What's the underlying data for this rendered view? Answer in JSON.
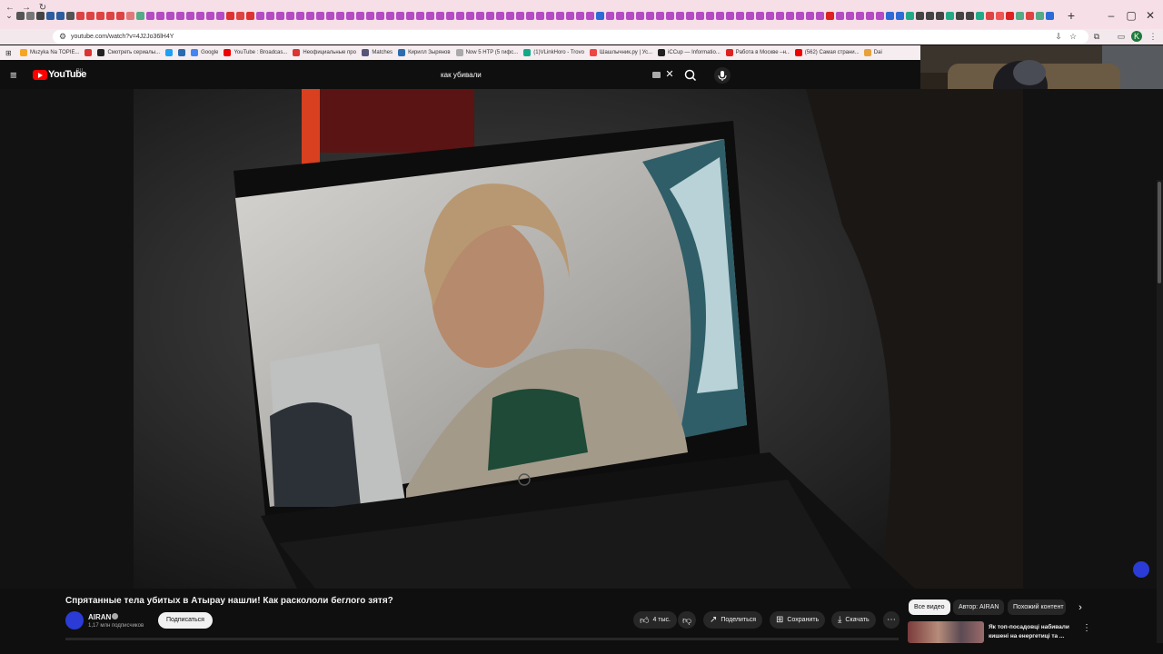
{
  "browser": {
    "url": "youtube.com/watch?v=4J2Jo36lH4Y",
    "tab_favicon_colors": [
      "#555",
      "#777",
      "#444",
      "#2d5d9f",
      "#2d5d9f",
      "#555",
      "#d44",
      "#d44",
      "#d44",
      "#d44",
      "#d44",
      "#e07a7a",
      "#5a8",
      "#b44cc4",
      "#b44cc4",
      "#b44cc4",
      "#b44cc4",
      "#b44cc4",
      "#b44cc4",
      "#b44cc4",
      "#b44cc4",
      "#d33",
      "#d44",
      "#d33",
      "#b44cc4",
      "#b44cc4",
      "#b44cc4",
      "#b44cc4",
      "#b44cc4",
      "#b44cc4",
      "#b44cc4",
      "#b44cc4",
      "#b44cc4",
      "#b44cc4",
      "#b44cc4",
      "#b44cc4",
      "#b44cc4",
      "#b44cc4",
      "#b44cc4",
      "#b44cc4",
      "#b44cc4",
      "#b44cc4",
      "#b44cc4",
      "#b44cc4",
      "#b44cc4",
      "#b44cc4",
      "#b44cc4",
      "#b44cc4",
      "#b44cc4",
      "#b44cc4",
      "#b44cc4",
      "#b44cc4",
      "#b44cc4",
      "#b44cc4",
      "#b44cc4",
      "#b44cc4",
      "#b44cc4",
      "#b44cc4",
      "#2d6bd6",
      "#b44cc4",
      "#b44cc4",
      "#b44cc4",
      "#b44cc4",
      "#b44cc4",
      "#b44cc4",
      "#b44cc4",
      "#b44cc4",
      "#b44cc4",
      "#b44cc4",
      "#b44cc4",
      "#b44cc4",
      "#b44cc4",
      "#b44cc4",
      "#b44cc4",
      "#b44cc4",
      "#b44cc4",
      "#b44cc4",
      "#b44cc4",
      "#b44cc4",
      "#b44cc4",
      "#b44cc4",
      "#d22",
      "#b44cc4",
      "#b44cc4",
      "#b44cc4",
      "#b44cc4",
      "#b44cc4",
      "#2d6bd6",
      "#2d6bd6",
      "#2a8",
      "#444",
      "#444",
      "#444",
      "#2a8",
      "#444",
      "#444",
      "#2a8",
      "#d44",
      "#e55",
      "#d22",
      "#5a8",
      "#d44",
      "#5a8",
      "#2d6bd6"
    ]
  },
  "bookmarks": [
    {
      "label": "Muzyka Na TOPIE...",
      "color": "#f5a623"
    },
    {
      "label": "",
      "color": "#d33"
    },
    {
      "label": "Смотреть сериалы...",
      "color": "#222"
    },
    {
      "label": "",
      "color": "#1da1f2"
    },
    {
      "label": "",
      "color": "#2b6cb0"
    },
    {
      "label": "Google",
      "color": "#4285f4"
    },
    {
      "label": "YouTube : Broadcas...",
      "color": "#e00"
    },
    {
      "label": "Неофициальные прох...",
      "color": "#d33"
    },
    {
      "label": "Matches",
      "color": "#557"
    },
    {
      "label": "Кирилл Зырянов",
      "color": "#2b6cb0"
    },
    {
      "label": "Now 5 HTP (5 гифс...",
      "color": "#aaa"
    },
    {
      "label": "(1)VLinkHoro - Trovo",
      "color": "#1a8"
    },
    {
      "label": "Шашлычник.ру | Ус...",
      "color": "#e44"
    },
    {
      "label": "iCCup — Informatio...",
      "color": "#222"
    },
    {
      "label": "Работа в Москве –н...",
      "color": "#d22"
    },
    {
      "label": "(562) Самая страни...",
      "color": "#e00"
    },
    {
      "label": "Dai",
      "color": "#e8a13a"
    }
  ],
  "youtube": {
    "logo_text": "YouTube",
    "country_code": "RU",
    "search_query": "как убивали"
  },
  "video": {
    "title": "Спрятанные тела убитых в Атырау нашли! Как раскололи беглого зятя?",
    "channel": "AIRAN",
    "subscribers": "1,17 млн подписчиков",
    "subscribe_label": "Подписаться",
    "likes": "4 тыс.",
    "share_label": "Поделиться",
    "save_label": "Сохранить",
    "download_label": "Скачать"
  },
  "chips": [
    "Все видео",
    "Автор: AIRAN",
    "Похожий контент"
  ],
  "recommendation": {
    "title": "Як топ-посадовці набивали кишені на енергетиці та ..."
  },
  "icons": {
    "menu": "menu-icon",
    "search": "search-icon",
    "mic": "mic-icon",
    "like": "thumb-up-icon",
    "dislike": "thumb-down-icon",
    "share": "share-icon",
    "save": "bookmark-icon",
    "download": "download-icon",
    "more": "more-icon"
  },
  "colors": {
    "youtube_red": "#ff0000",
    "background": "#0f0f0f",
    "tabbar": "#f6dfe6",
    "accent_blue": "#2b3bd6"
  }
}
